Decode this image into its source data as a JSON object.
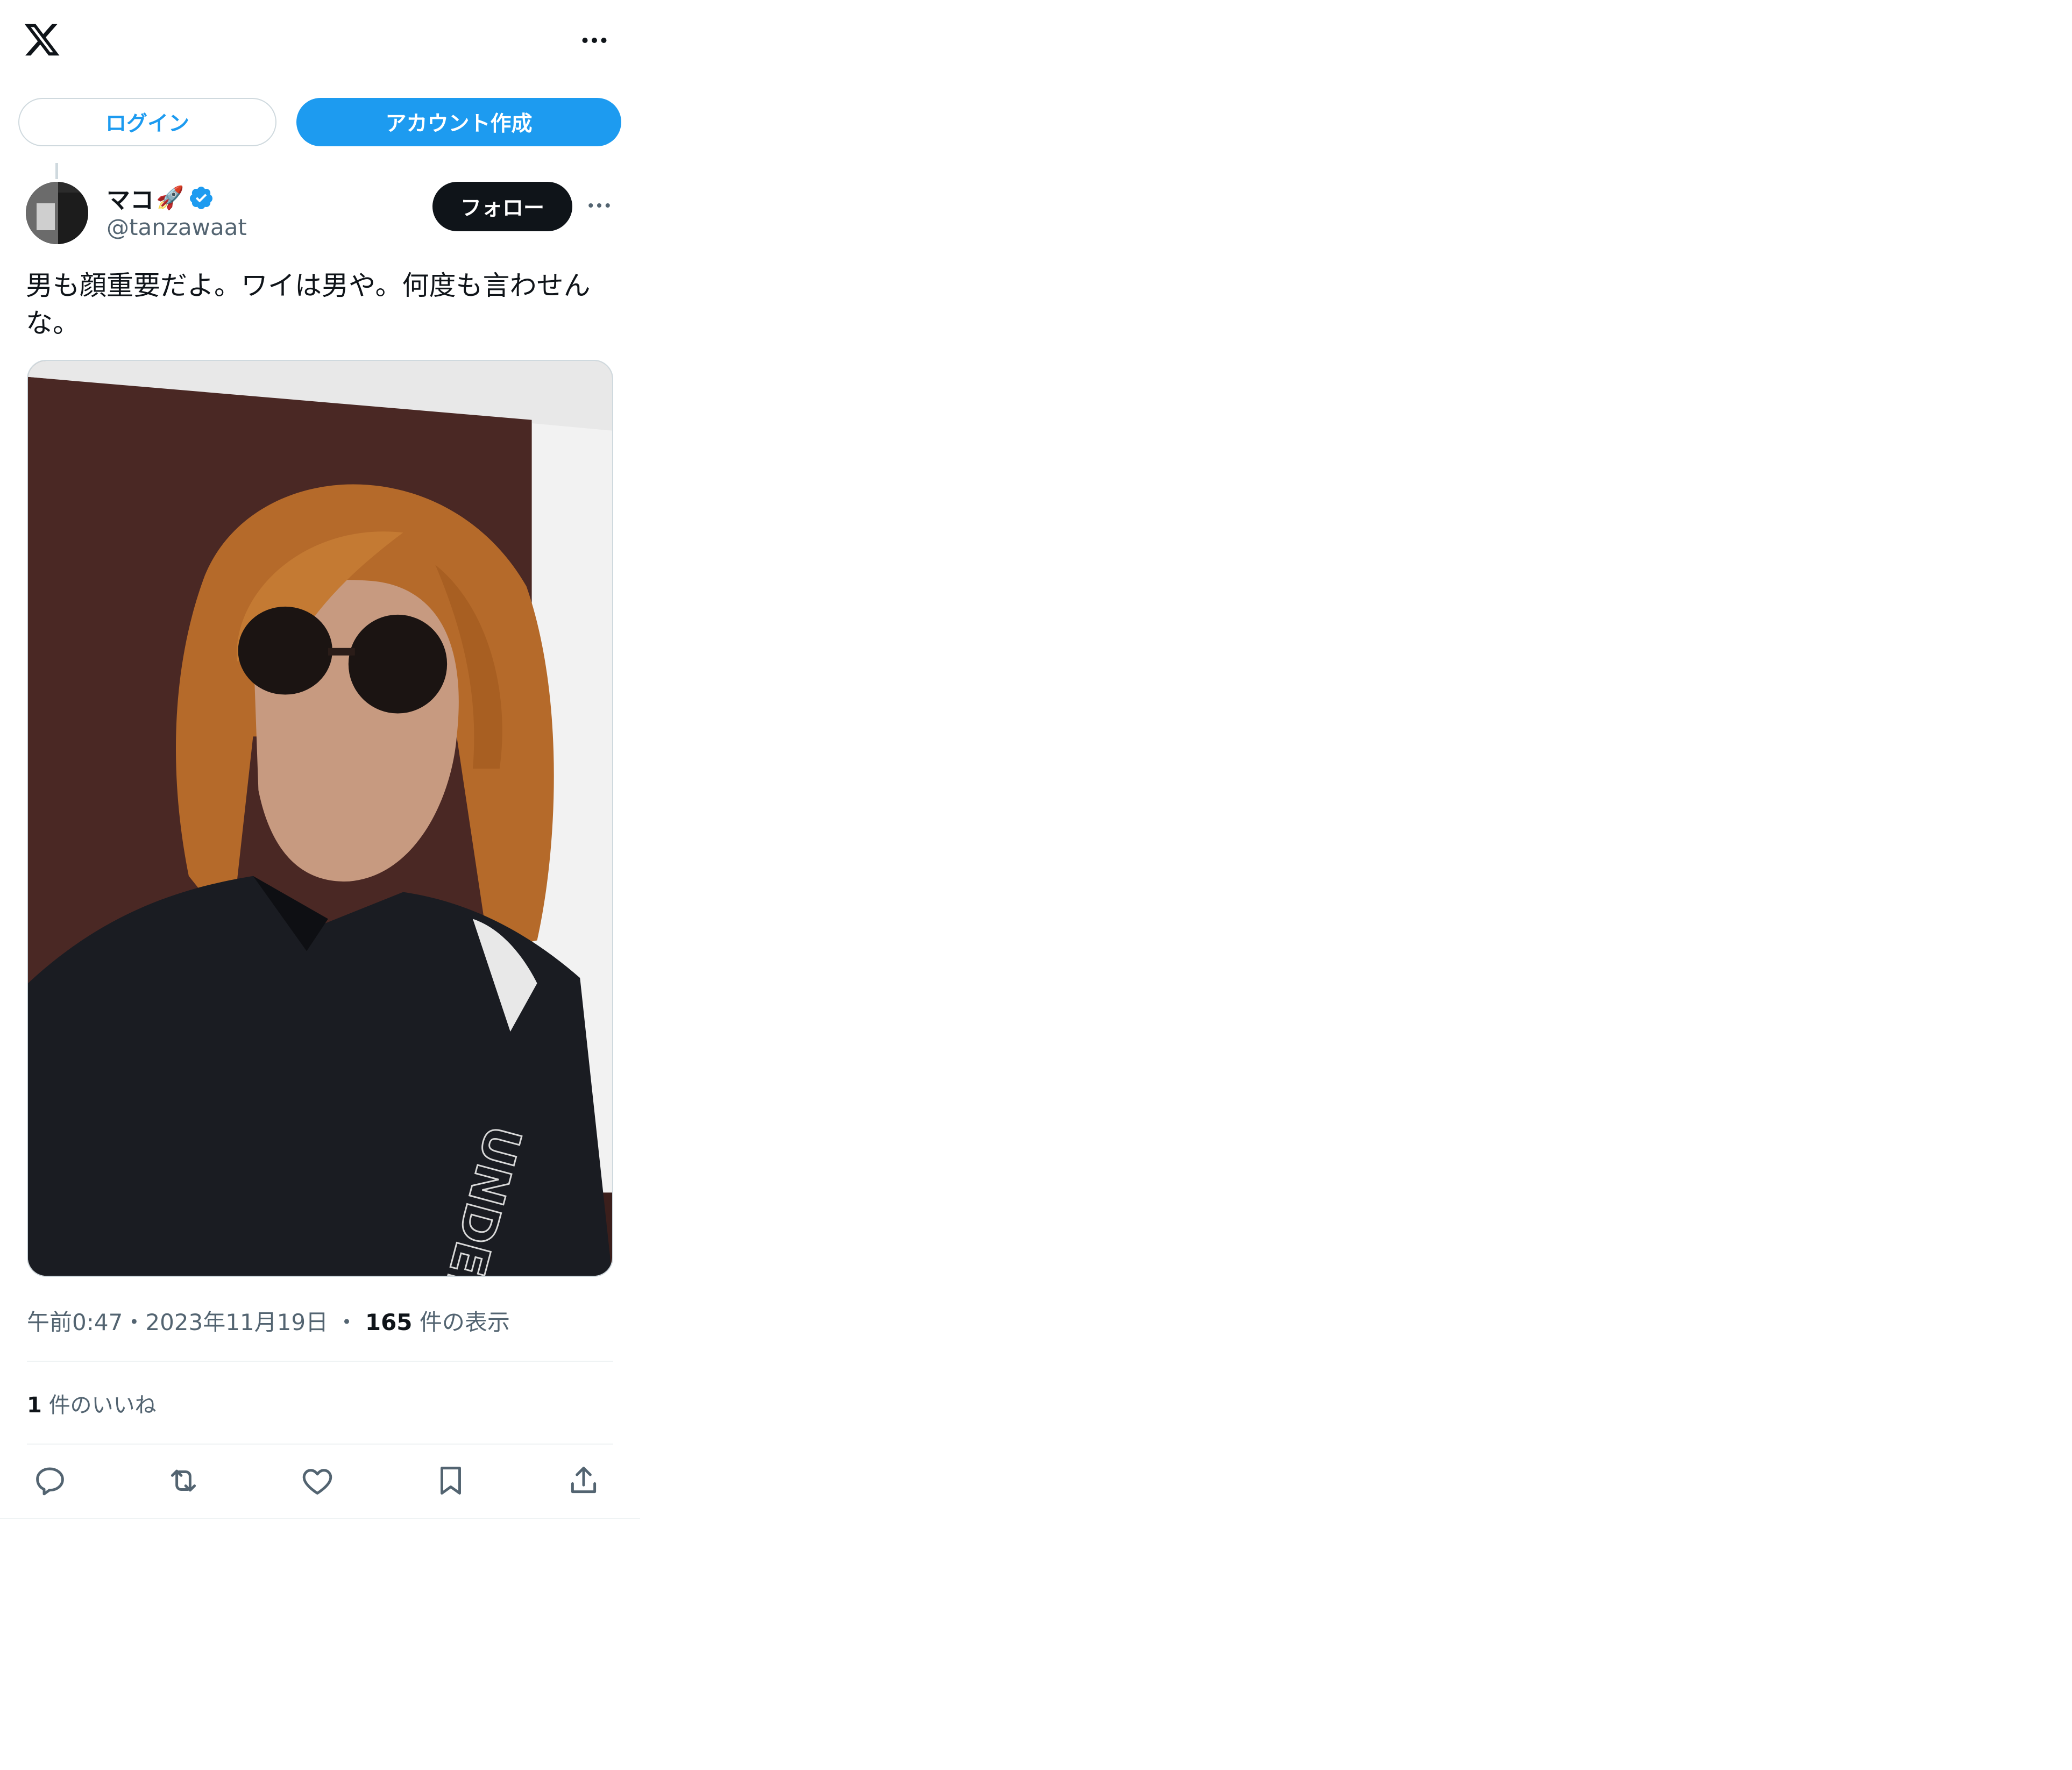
{
  "header": {
    "logo_icon": "x-logo-icon",
    "more_icon": "more-horizontal-icon"
  },
  "auth": {
    "login_label": "ログイン",
    "signup_label": "アカウント作成"
  },
  "tweet": {
    "author": {
      "display_name": "マコ",
      "name_emoji": "🚀",
      "verified_icon": "verified-badge-icon",
      "handle": "@tanzawaat"
    },
    "follow_label": "フォロー",
    "text": "男も顔重要だよ。ワイは男や。何度も言わせんな。",
    "media": {
      "type": "photo"
    },
    "meta": {
      "time": "午前0:47",
      "separator1": "・",
      "date": "2023年11月19日",
      "separator2": "・",
      "views_count": "165",
      "views_label": "件の表示"
    },
    "likes": {
      "count": "1",
      "label": "件のいいね"
    },
    "actions": [
      {
        "icon": "reply-icon"
      },
      {
        "icon": "retweet-icon"
      },
      {
        "icon": "like-icon"
      },
      {
        "icon": "bookmark-icon"
      },
      {
        "icon": "share-icon"
      }
    ]
  },
  "colors": {
    "accent": "#1d9bf0",
    "text_primary": "#0f1419",
    "text_secondary": "#536471",
    "border": "#cfd9de",
    "follow_bg": "#0f1419"
  }
}
